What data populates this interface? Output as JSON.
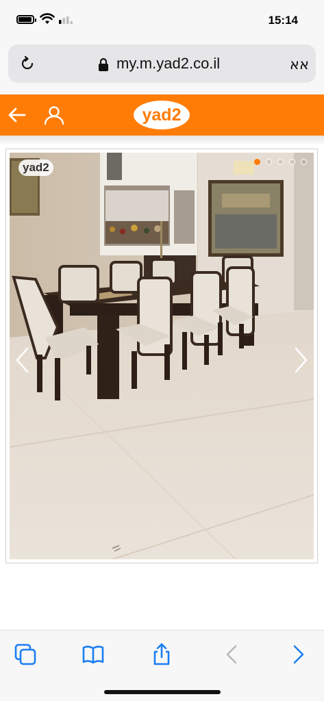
{
  "status_bar": {
    "time": "15:14",
    "battery_level": 0.85,
    "icons": [
      "battery-icon",
      "wifi-icon",
      "signal-icon"
    ]
  },
  "browser": {
    "url": "my.m.yad2.co.il",
    "text_size_button": "אא",
    "icons": [
      "reload-icon",
      "lock-icon"
    ]
  },
  "site_header": {
    "logo": "yad2",
    "background_color": "#ff7c07",
    "icons": [
      "back-arrow-icon",
      "user-icon"
    ]
  },
  "gallery": {
    "watermark": "yad2",
    "total_images": 5,
    "active_index": 1,
    "accent_color": "#ff7c07",
    "icons": [
      "chevron-left-icon",
      "chevron-right-icon"
    ]
  },
  "bottom_toolbar": {
    "icons": [
      "tabs-icon",
      "bookmarks-icon",
      "share-icon",
      "back-chevron-icon",
      "forward-chevron-icon"
    ]
  }
}
